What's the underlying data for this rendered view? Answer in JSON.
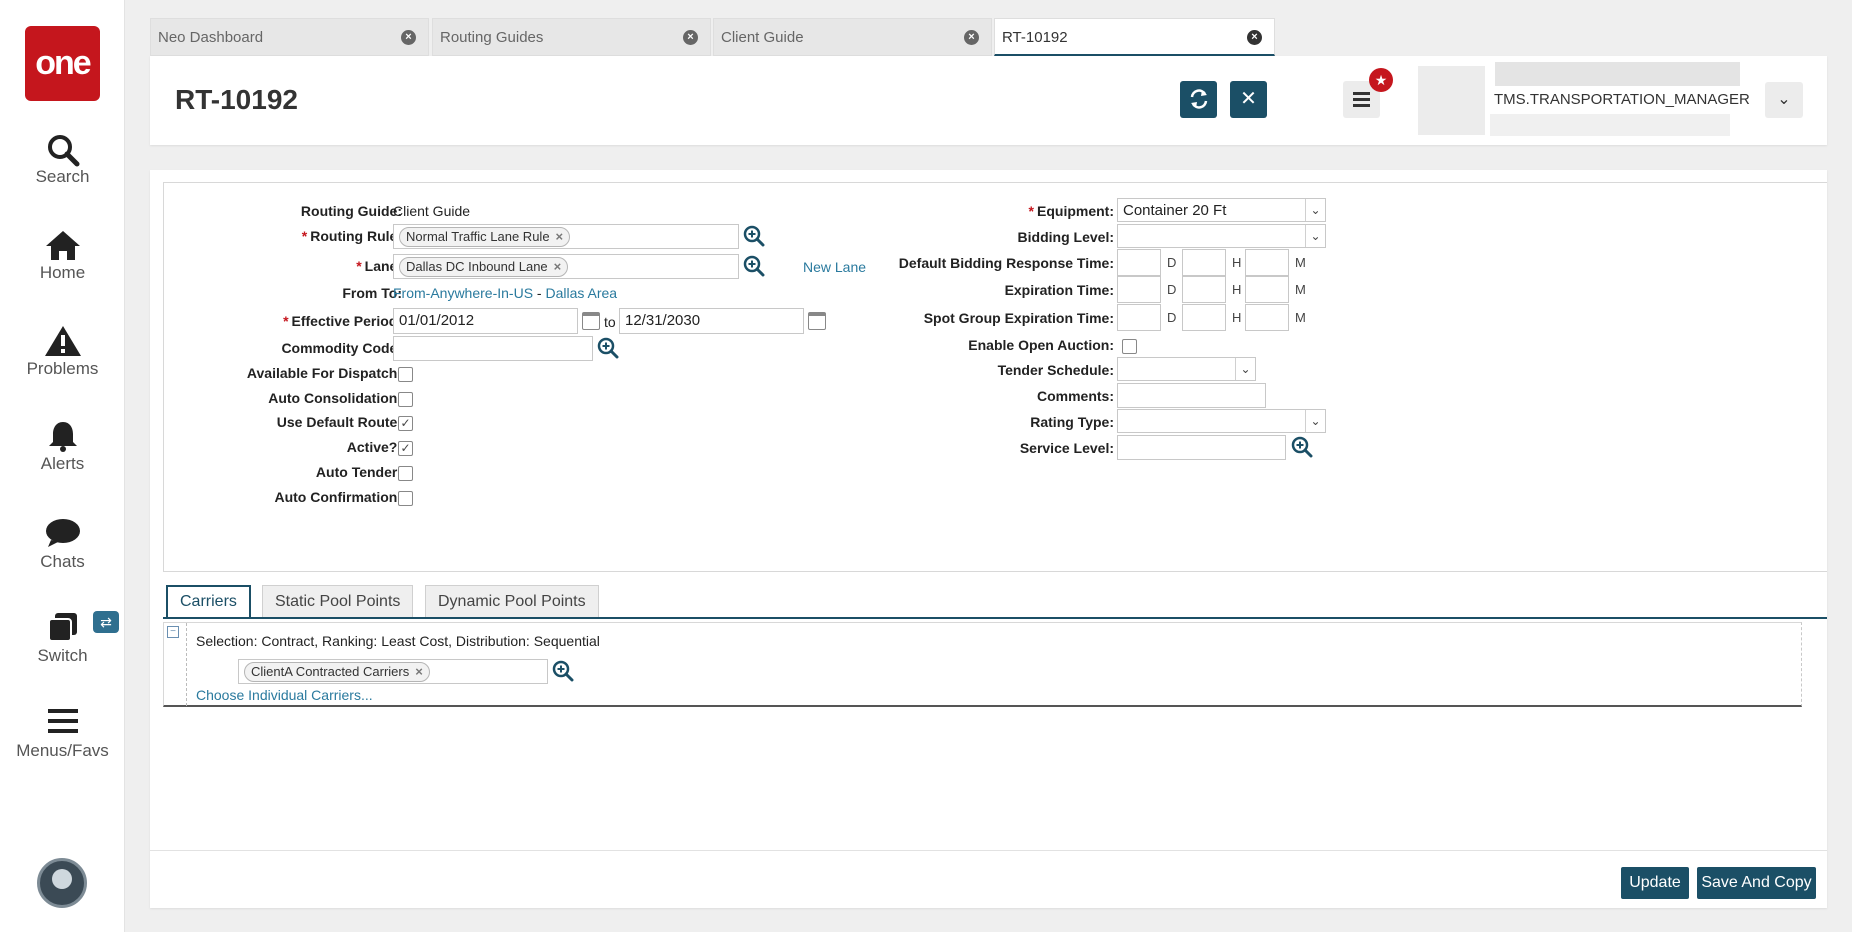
{
  "nav": {
    "logo": "one",
    "items": [
      {
        "label": "Search",
        "icon": "search-icon"
      },
      {
        "label": "Home",
        "icon": "home-icon"
      },
      {
        "label": "Problems",
        "icon": "warning-icon"
      },
      {
        "label": "Alerts",
        "icon": "bell-icon"
      },
      {
        "label": "Chats",
        "icon": "chat-icon"
      },
      {
        "label": "Switch",
        "icon": "switch-icon"
      },
      {
        "label": "Menus/Favs",
        "icon": "hamburger-icon"
      }
    ]
  },
  "tabs": [
    "Neo Dashboard",
    "Routing Guides",
    "Client Guide",
    "RT-10192"
  ],
  "header": {
    "title": "RT-10192",
    "user_role": "TMS.TRANSPORTATION_MANAGER"
  },
  "form": {
    "routing_guide_label": "Routing Guide:",
    "routing_guide_value": "Client Guide",
    "routing_rule_label": "Routing Rule:",
    "routing_rule_chip": "Normal Traffic Lane Rule",
    "lane_label": "Lane:",
    "lane_chip": "Dallas DC Inbound Lane",
    "new_lane": "New Lane",
    "from_to_label": "From To:",
    "from_value": "From-Anywhere-In-US",
    "dash": "-",
    "to_value": "Dallas Area",
    "effective_period_label": "Effective Period:",
    "effective_start": "01/01/2012",
    "to_word": "to",
    "effective_end": "12/31/2030",
    "commodity_code_label": "Commodity Code:",
    "available_for_dispatch_label": "Available For Dispatch:",
    "auto_consolidation_label": "Auto Consolidation:",
    "use_default_route_label": "Use Default Route:",
    "active_label": "Active?:",
    "auto_tender_label": "Auto Tender:",
    "auto_confirmation_label": "Auto Confirmation:",
    "equipment_label": "Equipment:",
    "equipment_value": "Container 20 Ft",
    "bidding_level_label": "Bidding Level:",
    "default_bidding_label": "Default Bidding Response Time:",
    "expiration_time_label": "Expiration Time:",
    "spot_group_label": "Spot Group Expiration Time:",
    "unit_d": "D",
    "unit_h": "H",
    "unit_m": "M",
    "enable_open_auction_label": "Enable Open Auction:",
    "tender_schedule_label": "Tender Schedule:",
    "comments_label": "Comments:",
    "rating_type_label": "Rating Type:",
    "service_level_label": "Service Level:"
  },
  "checkboxes": {
    "available_for_dispatch": false,
    "auto_consolidation": false,
    "use_default_route": true,
    "active": true,
    "auto_tender": false,
    "auto_confirmation": false,
    "enable_open_auction": false
  },
  "subtabs": [
    "Carriers",
    "Static Pool Points",
    "Dynamic Pool Points"
  ],
  "carriers": {
    "selection_text": "Selection: Contract, Ranking: Least Cost, Distribution: Sequential",
    "carrier_chip": "ClientA Contracted Carriers",
    "choose_link": "Choose Individual Carriers..."
  },
  "footer": {
    "update": "Update",
    "save_and_copy": "Save And Copy"
  },
  "colors": {
    "brand_red": "#c5161d",
    "primary_teal": "#1b4f66",
    "link": "#2a7a9e"
  }
}
